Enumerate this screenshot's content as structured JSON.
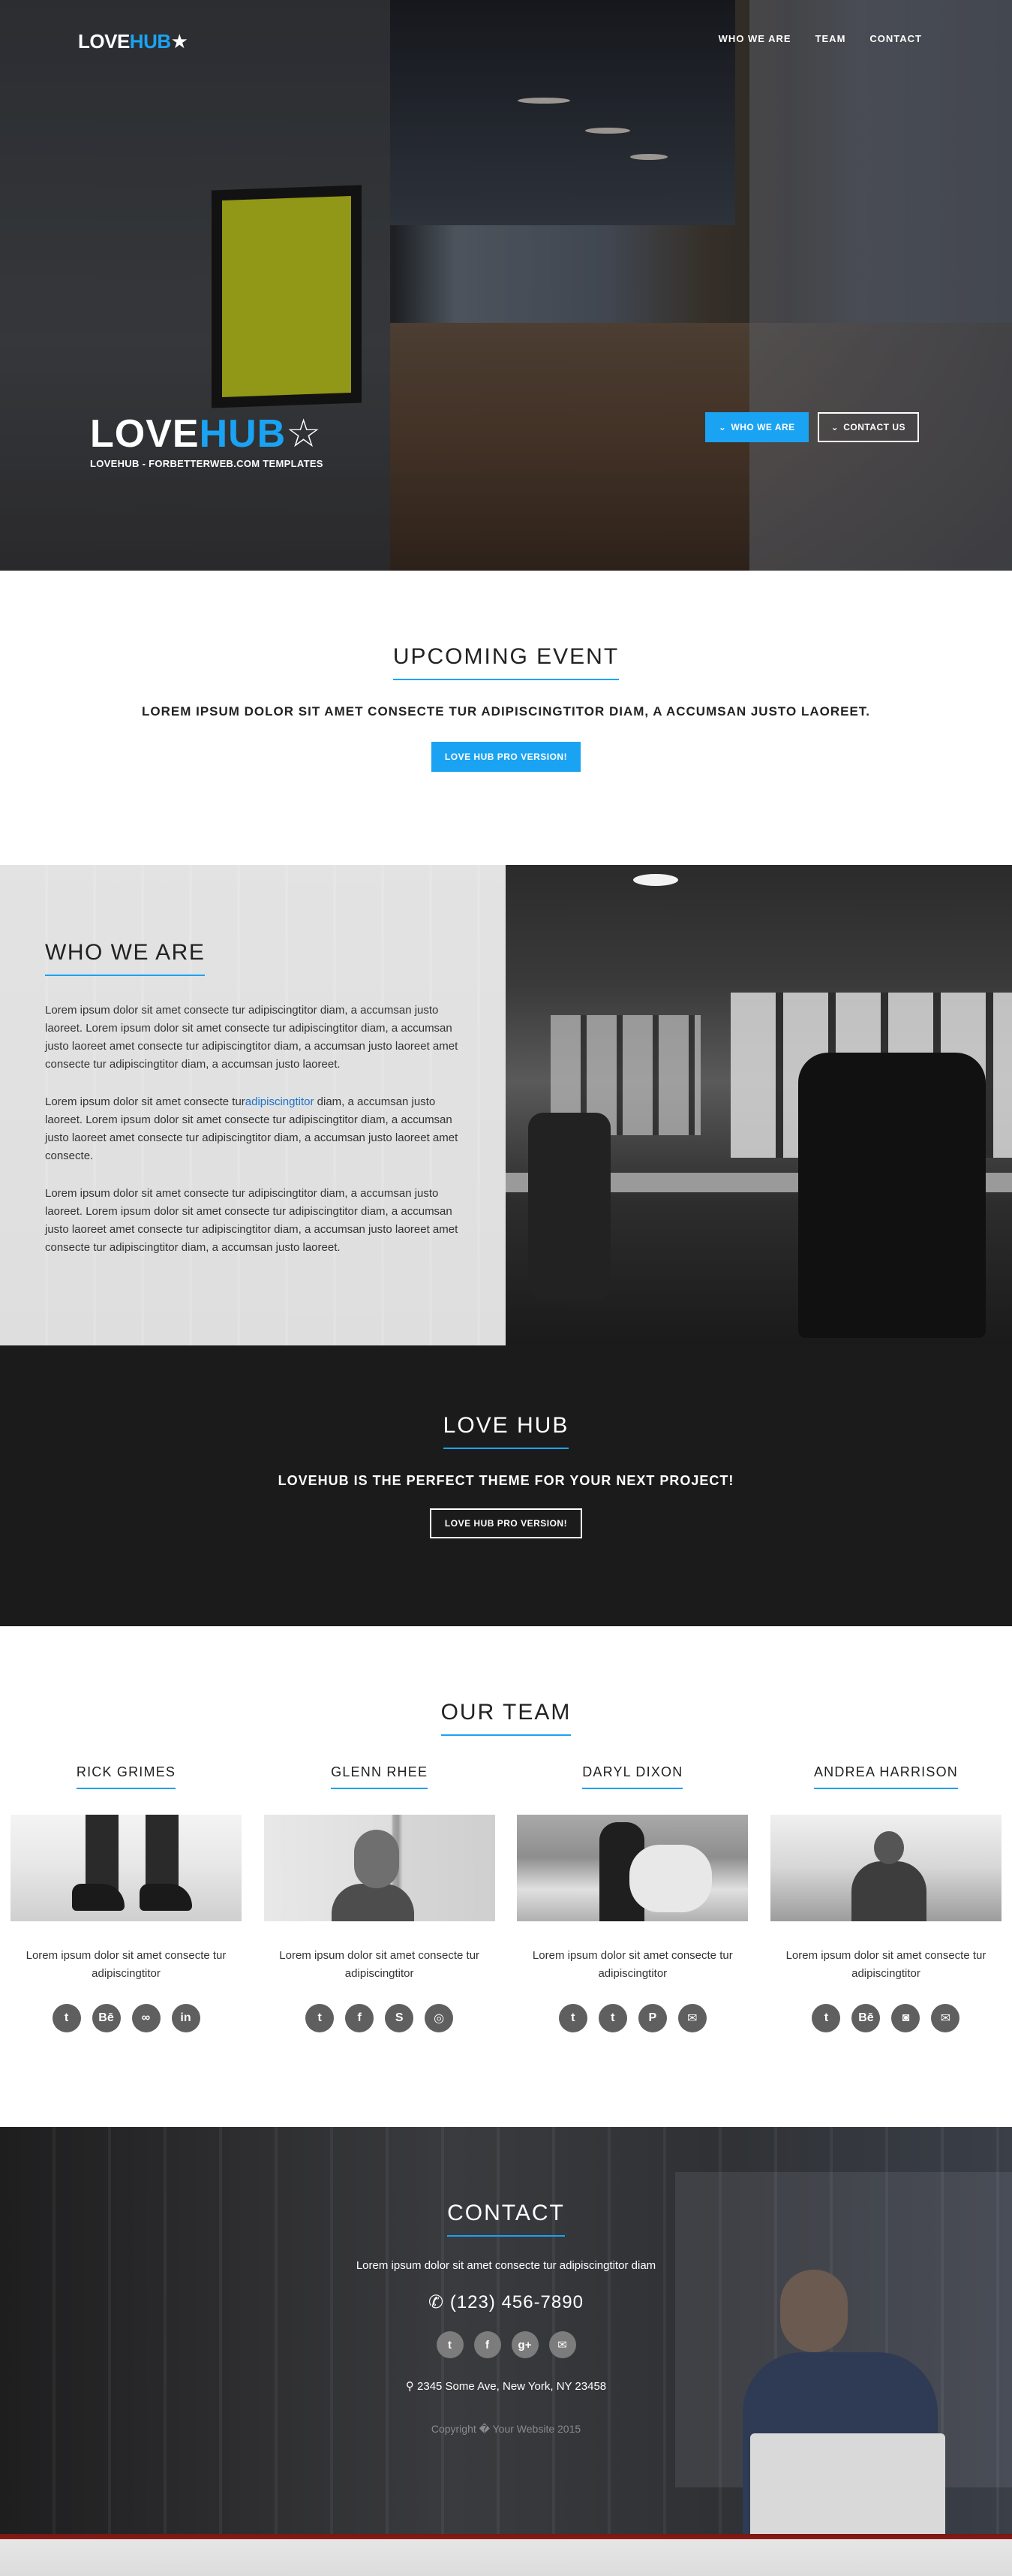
{
  "nav": {
    "brand_love": "LOVE",
    "brand_hub": "HUB",
    "items": [
      "WHO WE ARE",
      "TEAM",
      "CONTACT"
    ]
  },
  "hero": {
    "title_love": "LOVE",
    "title_hub": "HUB",
    "subtitle": "LOVEHUB - FORBETTERWEB.COM TEMPLATES",
    "btn_who": "WHO WE ARE",
    "btn_contact": "CONTACT US",
    "chevron_icon": "chevron-down-icon",
    "star_icon": "star-outline-icon"
  },
  "event": {
    "title": "UPCOMING EVENT",
    "lead": "LOREM IPSUM DOLOR SIT AMET CONSECTE TUR ADIPISCINGTITOR DIAM, A ACCUMSAN JUSTO LAOREET.",
    "cta": "LOVE HUB PRO VERSION!"
  },
  "who": {
    "title": "WHO WE ARE",
    "p1": "Lorem ipsum dolor sit amet consecte tur adipiscingtitor diam, a accumsan justo laoreet. Lorem ipsum dolor sit amet consecte tur adipiscingtitor diam, a accumsan justo laoreet amet consecte tur adipiscingtitor diam, a accumsan justo laoreet amet consecte tur adipiscingtitor diam, a accumsan justo laoreet.",
    "p2_before": "Lorem ipsum dolor sit amet consecte tur",
    "p2_link": "adipiscingtitor",
    "p2_after": " diam, a accumsan justo laoreet. Lorem ipsum dolor sit amet consecte tur adipiscingtitor diam, a accumsan justo laoreet amet consecte tur adipiscingtitor diam, a accumsan justo laoreet amet consecte.",
    "p3": "Lorem ipsum dolor sit amet consecte tur adipiscingtitor diam, a accumsan justo laoreet. Lorem ipsum dolor sit amet consecte tur adipiscingtitor diam, a accumsan justo laoreet amet consecte tur adipiscingtitor diam, a accumsan justo laoreet amet consecte tur adipiscingtitor diam, a accumsan justo laoreet."
  },
  "lovehub": {
    "title": "LOVE HUB",
    "lead": "LOVEHUB IS THE PERFECT THEME FOR YOUR NEXT PROJECT!",
    "cta": "LOVE HUB PRO VERSION!"
  },
  "team": {
    "title": "OUR TEAM",
    "members": [
      {
        "name": "RICK GRIMES",
        "bio": "Lorem ipsum dolor sit amet consecte tur adipiscingtitor",
        "socials": [
          "twitter-icon",
          "behance-icon",
          "link-icon",
          "linkedin-icon"
        ],
        "glyphs": [
          "t",
          "Bē",
          "∞",
          "in"
        ]
      },
      {
        "name": "GLENN RHEE",
        "bio": "Lorem ipsum dolor sit amet consecte tur adipiscingtitor",
        "socials": [
          "twitter-icon",
          "facebook-icon",
          "skype-icon",
          "dribbble-icon"
        ],
        "glyphs": [
          "t",
          "f",
          "S",
          "◎"
        ]
      },
      {
        "name": "DARYL DIXON",
        "bio": "Lorem ipsum dolor sit amet consecte tur adipiscingtitor",
        "socials": [
          "twitter-icon",
          "tumblr-icon",
          "pinterest-icon",
          "envelope-icon"
        ],
        "glyphs": [
          "t",
          "t",
          "P",
          "✉"
        ]
      },
      {
        "name": "ANDREA HARRISON",
        "bio": "Lorem ipsum dolor sit amet consecte tur adipiscingtitor",
        "socials": [
          "twitter-icon",
          "behance-icon",
          "instagram-icon",
          "envelope-icon"
        ],
        "glyphs": [
          "t",
          "Bē",
          "◙",
          "✉"
        ]
      }
    ]
  },
  "contact": {
    "title": "CONTACT",
    "lead": "Lorem ipsum dolor sit amet consecte tur adipiscingtitor diam",
    "phone": "(123) 456-7890",
    "phone_icon": "phone-icon",
    "socials": [
      "twitter-icon",
      "facebook-icon",
      "google-plus-icon",
      "envelope-icon"
    ],
    "glyphs": [
      "t",
      "f",
      "g+",
      "✉"
    ],
    "address": "2345 Some Ave, New York, NY 23458",
    "address_icon": "map-marker-icon",
    "copyright": "Copyright � Your Website 2015"
  },
  "colors": {
    "accent": "#1aa3f2",
    "dark_section": "#1b1b1c",
    "social_bg": "#5f5f5f"
  }
}
